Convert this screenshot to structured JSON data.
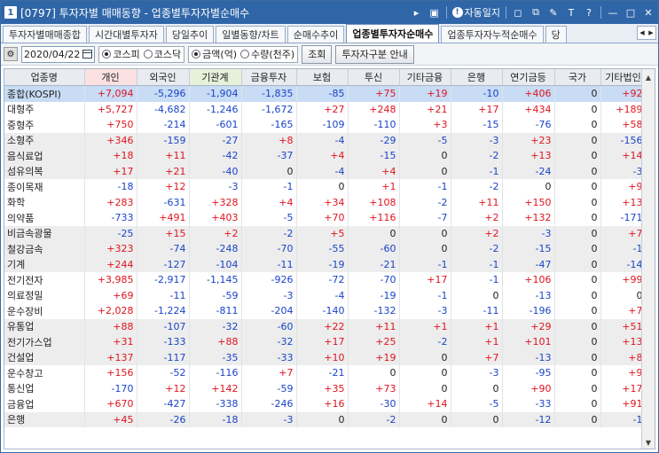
{
  "window": {
    "number": "1",
    "title": "[0797] 투자자별 매매동향 - 업종별투자자별순매수",
    "alarm_label": "자동일지",
    "title_icons": [
      "play-icon",
      "screen-icon",
      "alarm-icon",
      "window-icon",
      "copy-icon",
      "tool-icon",
      "font-icon",
      "help-icon",
      "minimize-icon",
      "maximize-icon",
      "close-icon"
    ]
  },
  "tabs": [
    {
      "label": "투자자별매매종합",
      "active": false
    },
    {
      "label": "시간대별투자자",
      "active": false
    },
    {
      "label": "당일추이",
      "active": false
    },
    {
      "label": "일별동향/차트",
      "active": false
    },
    {
      "label": "순매수추이",
      "active": false
    },
    {
      "label": "업종별투자자순매수",
      "active": true
    },
    {
      "label": "업종투자자누적순매수",
      "active": false
    },
    {
      "label": "당",
      "active": false
    }
  ],
  "toolbar": {
    "date": "2020/04/22",
    "market_options": [
      "코스피",
      "코스닥"
    ],
    "market_selected": "코스피",
    "unit_options": [
      "금액(억)",
      "수량(천주)"
    ],
    "unit_selected": "금액(억)",
    "query_button": "조회",
    "guide_button": "투자자구분 안내"
  },
  "table": {
    "columns": [
      "업종명",
      "개인",
      "외국인",
      "기관계",
      "금융투자",
      "보험",
      "투신",
      "기타금융",
      "은행",
      "연기금등",
      "국가",
      "기타법인"
    ],
    "rows": [
      {
        "name": "종합(KOSPI)",
        "values": [
          "+7,094",
          "-5,296",
          "-1,904",
          "-1,835",
          "-85",
          "+75",
          "+19",
          "-10",
          "+406",
          "0",
          "+92"
        ],
        "group": "sel"
      },
      {
        "name": "대형주",
        "values": [
          "+5,727",
          "-4,682",
          "-1,246",
          "-1,672",
          "+27",
          "+248",
          "+21",
          "+17",
          "+434",
          "0",
          "+189"
        ],
        "group": "g0"
      },
      {
        "name": "중형주",
        "values": [
          "+750",
          "-214",
          "-601",
          "-165",
          "-109",
          "-110",
          "+3",
          "-15",
          "-76",
          "0",
          "+58"
        ],
        "group": "g0"
      },
      {
        "name": "소형주",
        "values": [
          "+346",
          "-159",
          "-27",
          "+8",
          "-4",
          "-29",
          "-5",
          "-3",
          "+23",
          "0",
          "-156"
        ],
        "group": "g1"
      },
      {
        "name": "음식료업",
        "values": [
          "+18",
          "+11",
          "-42",
          "-37",
          "+4",
          "-15",
          "0",
          "-2",
          "+13",
          "0",
          "+14"
        ],
        "group": "g1"
      },
      {
        "name": "섬유의복",
        "values": [
          "+17",
          "+21",
          "-40",
          "0",
          "-4",
          "+4",
          "0",
          "-1",
          "-24",
          "0",
          "-3"
        ],
        "group": "g1"
      },
      {
        "name": "종이목재",
        "values": [
          "-18",
          "+12",
          "-3",
          "-1",
          "0",
          "+1",
          "-1",
          "-2",
          "0",
          "0",
          "+9"
        ],
        "group": "g0"
      },
      {
        "name": "화학",
        "values": [
          "+283",
          "-631",
          "+328",
          "+4",
          "+34",
          "+108",
          "-2",
          "+11",
          "+150",
          "0",
          "+13"
        ],
        "group": "g0"
      },
      {
        "name": "의약품",
        "values": [
          "-733",
          "+491",
          "+403",
          "-5",
          "+70",
          "+116",
          "-7",
          "+2",
          "+132",
          "0",
          "-171"
        ],
        "group": "g0"
      },
      {
        "name": "비금속광물",
        "values": [
          "-25",
          "+15",
          "+2",
          "-2",
          "+5",
          "0",
          "0",
          "+2",
          "-3",
          "0",
          "+7"
        ],
        "group": "g1"
      },
      {
        "name": "철강금속",
        "values": [
          "+323",
          "-74",
          "-248",
          "-70",
          "-55",
          "-60",
          "0",
          "-2",
          "-15",
          "0",
          "-1"
        ],
        "group": "g1"
      },
      {
        "name": "기계",
        "values": [
          "+244",
          "-127",
          "-104",
          "-11",
          "-19",
          "-21",
          "-1",
          "-1",
          "-47",
          "0",
          "-14"
        ],
        "group": "g1"
      },
      {
        "name": "전기전자",
        "values": [
          "+3,985",
          "-2,917",
          "-1,145",
          "-926",
          "-72",
          "-70",
          "+17",
          "-1",
          "+106",
          "0",
          "+99"
        ],
        "group": "g0"
      },
      {
        "name": "의료정밀",
        "values": [
          "+69",
          "-11",
          "-59",
          "-3",
          "-4",
          "-19",
          "-1",
          "0",
          "-13",
          "0",
          "0"
        ],
        "group": "g0"
      },
      {
        "name": "운수장비",
        "values": [
          "+2,028",
          "-1,224",
          "-811",
          "-204",
          "-140",
          "-132",
          "-3",
          "-11",
          "-196",
          "0",
          "+7"
        ],
        "group": "g0"
      },
      {
        "name": "유통업",
        "values": [
          "+88",
          "-107",
          "-32",
          "-60",
          "+22",
          "+11",
          "+1",
          "+1",
          "+29",
          "0",
          "+51"
        ],
        "group": "g1"
      },
      {
        "name": "전기가스업",
        "values": [
          "+31",
          "-133",
          "+88",
          "-32",
          "+17",
          "+25",
          "-2",
          "+1",
          "+101",
          "0",
          "+13"
        ],
        "group": "g1"
      },
      {
        "name": "건설업",
        "values": [
          "+137",
          "-117",
          "-35",
          "-33",
          "+10",
          "+19",
          "0",
          "+7",
          "-13",
          "0",
          "+8"
        ],
        "group": "g1"
      },
      {
        "name": "운수창고",
        "values": [
          "+156",
          "-52",
          "-116",
          "+7",
          "-21",
          "0",
          "0",
          "-3",
          "-95",
          "0",
          "+9"
        ],
        "group": "g0"
      },
      {
        "name": "통신업",
        "values": [
          "-170",
          "+12",
          "+142",
          "-59",
          "+35",
          "+73",
          "0",
          "0",
          "+90",
          "0",
          "+17"
        ],
        "group": "g0"
      },
      {
        "name": "금융업",
        "values": [
          "+670",
          "-427",
          "-338",
          "-246",
          "+16",
          "-30",
          "+14",
          "-5",
          "-33",
          "0",
          "+91"
        ],
        "group": "g0"
      },
      {
        "name": "은행",
        "values": [
          "+45",
          "-26",
          "-18",
          "-3",
          "0",
          "-2",
          "0",
          "0",
          "-12",
          "0",
          "-1"
        ],
        "group": "g1"
      }
    ]
  }
}
